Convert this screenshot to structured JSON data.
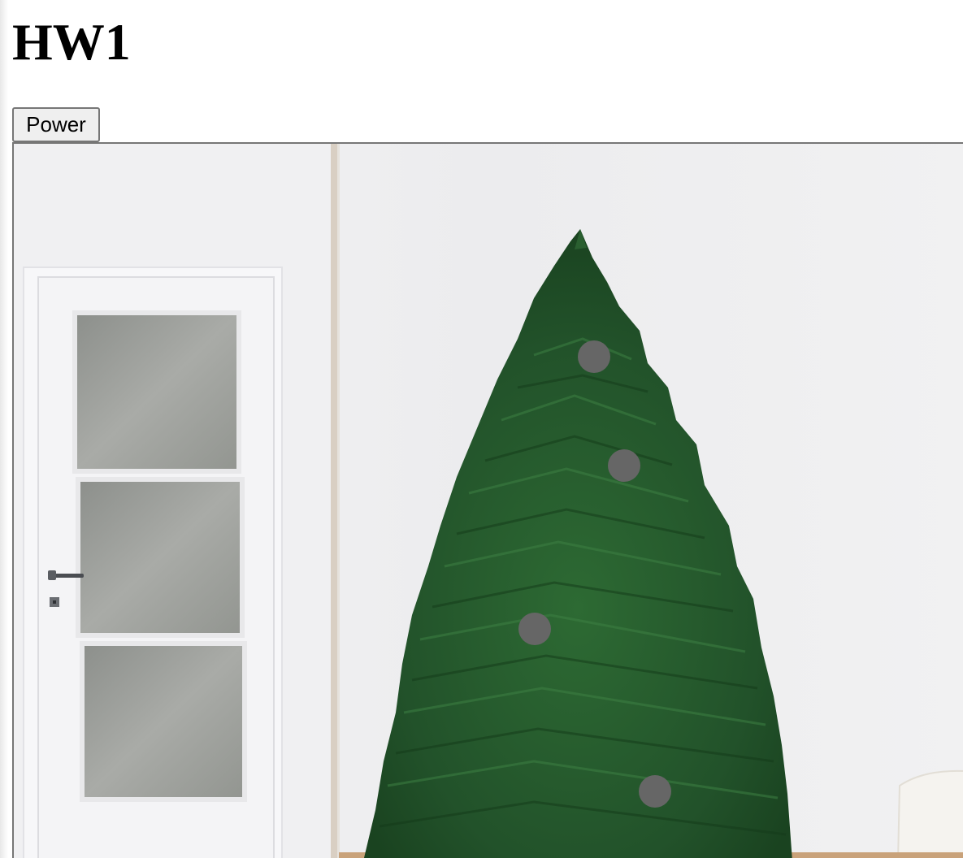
{
  "page": {
    "title": "HW1"
  },
  "controls": {
    "power_label": "Power"
  },
  "tree_lights": {
    "count": 4,
    "state": "off",
    "off_color": "#666666"
  },
  "colors": {
    "wall": "#ecedef",
    "door": "#f4f4f6",
    "tree": "#24572a"
  }
}
